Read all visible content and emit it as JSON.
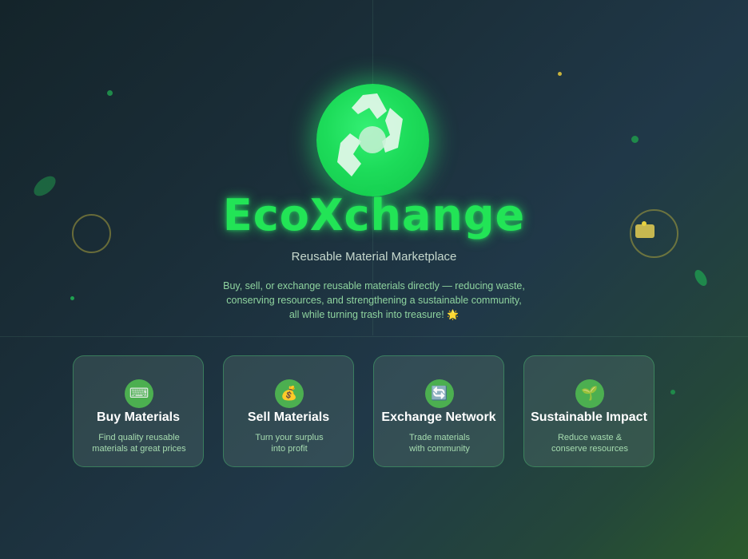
{
  "brand": {
    "title": "EcoXchange",
    "subtitle": "Reusable Material Marketplace",
    "description_line1": "Buy, sell, or exchange reusable materials directly — reducing waste,",
    "description_line2": "conserving resources, and strengthening a sustainable community,",
    "description_line3": "all while turning trash into treasure!",
    "description_emoji": "🌟",
    "logo_icon": "recycle-exchange-icon"
  },
  "colors": {
    "accent_green": "#22e456",
    "card_icon_bg": "#4caf50",
    "card_desc": "#a6dcb0",
    "decor_ring": "#aaa03c"
  },
  "features": [
    {
      "icon": "⌨",
      "icon_name": "keyboard-icon",
      "title": "Buy Materials",
      "desc_line1": "Find quality reusable",
      "desc_line2": "materials at great prices"
    },
    {
      "icon": "💰",
      "icon_name": "money-bag-icon",
      "title": "Sell Materials",
      "desc_line1": "Turn your surplus",
      "desc_line2": "into profit"
    },
    {
      "icon": "🔄",
      "icon_name": "exchange-arrows-icon",
      "title": "Exchange Network",
      "desc_line1": "Trade materials",
      "desc_line2": "with community"
    },
    {
      "icon": "🌱",
      "icon_name": "seedling-icon",
      "title": "Sustainable Impact",
      "desc_line1": "Reduce waste &",
      "desc_line2": "conserve resources"
    }
  ]
}
